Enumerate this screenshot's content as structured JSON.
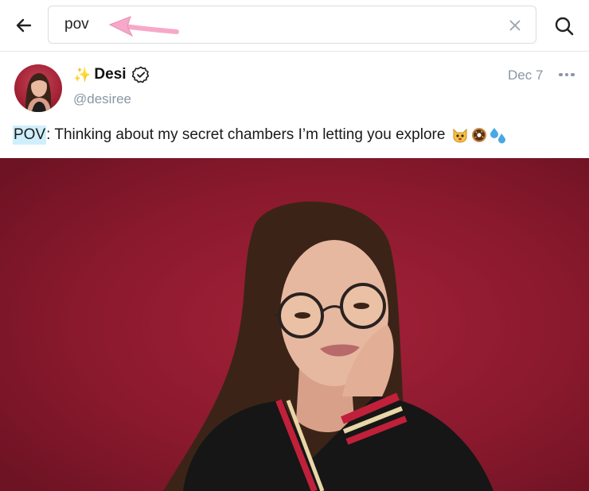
{
  "search": {
    "query": "pov",
    "placeholder": ""
  },
  "post": {
    "author_emoji": "✨",
    "author_name": "Desi",
    "username": "@desiree",
    "date": "Dec 7",
    "text_highlight": "POV",
    "text_rest": ": Thinking about my secret chambers I’m letting you explore",
    "emojis": [
      "cat-face-icon",
      "doughnut-icon",
      "sweat-droplets-icon"
    ]
  },
  "colors": {
    "accent_highlight": "#cfeffc",
    "muted_text": "#8a96a3",
    "annotation_arrow": "#f7a8c8",
    "media_background": "#8e1a2e"
  }
}
